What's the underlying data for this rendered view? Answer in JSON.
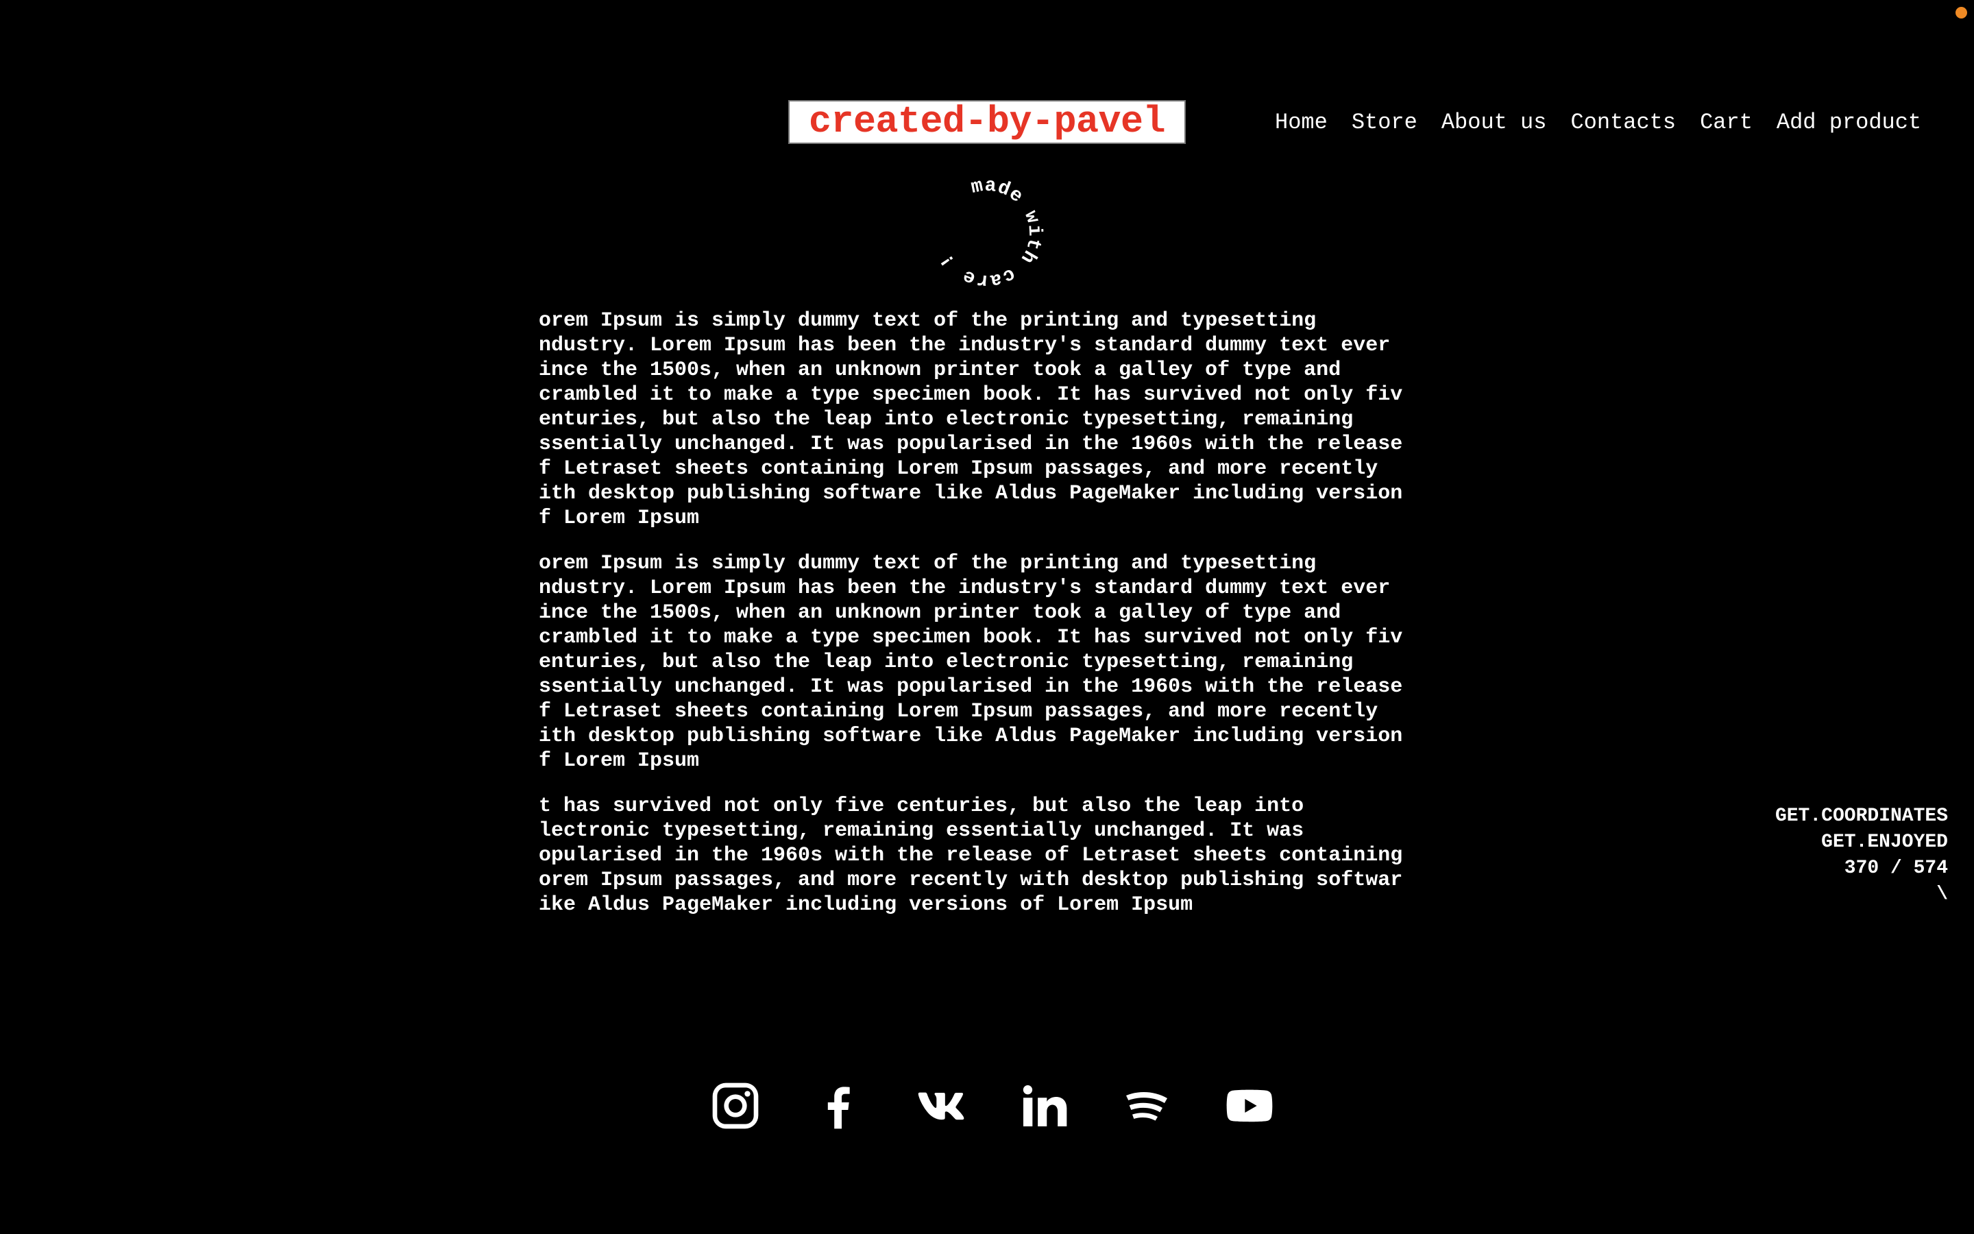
{
  "logo": {
    "text": "created-by-pavel"
  },
  "nav": {
    "items": [
      {
        "label": "Home"
      },
      {
        "label": "Store"
      },
      {
        "label": "About us"
      },
      {
        "label": "Contacts"
      },
      {
        "label": "Cart"
      },
      {
        "label": "Add product"
      }
    ]
  },
  "badge": {
    "circular_text": "made with care !!!!!!! "
  },
  "main": {
    "paragraphs": [
      "orem Ipsum is simply dummy text of the printing and typesetting\nndustry. Lorem Ipsum has been the industry's standard dummy text ever\nince the 1500s, when an unknown printer took a galley of type and\ncrambled it to make a type specimen book. It has survived not only fiv\nenturies, but also the leap into electronic typesetting, remaining\nssentially unchanged. It was popularised in the 1960s with the release\nf Letraset sheets containing Lorem Ipsum passages, and more recently\nith desktop publishing software like Aldus PageMaker including version\nf Lorem Ipsum",
      "orem Ipsum is simply dummy text of the printing and typesetting\nndustry. Lorem Ipsum has been the industry's standard dummy text ever\nince the 1500s, when an unknown printer took a galley of type and\ncrambled it to make a type specimen book. It has survived not only fiv\nenturies, but also the leap into electronic typesetting, remaining\nssentially unchanged. It was popularised in the 1960s with the release\nf Letraset sheets containing Lorem Ipsum passages, and more recently\nith desktop publishing software like Aldus PageMaker including version\nf Lorem Ipsum",
      "t has survived not only five centuries, but also the leap into\nlectronic typesetting, remaining essentially unchanged. It was\nopularised in the 1960s with the release of Letraset sheets containing\norem Ipsum passages, and more recently with desktop publishing softwar\nike Aldus PageMaker including versions of Lorem Ipsum"
    ]
  },
  "coords": {
    "line1": "GET.COORDINATES",
    "line2": "GET.ENJOYED",
    "line3": "370 / 574",
    "line4": "\\"
  },
  "social": {
    "icons": [
      "instagram-icon",
      "facebook-icon",
      "vk-icon",
      "linkedin-icon",
      "spotify-icon",
      "youtube-icon"
    ]
  },
  "colors": {
    "background": "#000000",
    "logo_text": "#e63526",
    "logo_bg": "#ffffff",
    "status_dot": "#f08a24"
  }
}
